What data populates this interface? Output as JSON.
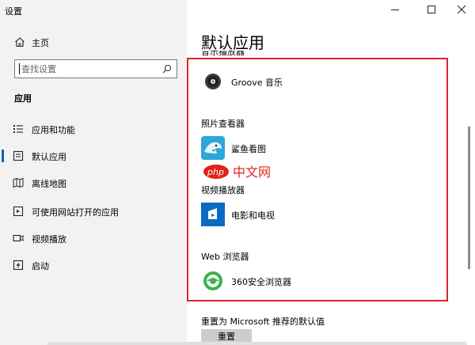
{
  "window": {
    "title": "设置"
  },
  "sidebar": {
    "home_label": "主页",
    "search_placeholder": "查找设置",
    "section_title": "应用",
    "items": [
      {
        "label": "应用和功能",
        "icon": "list-icon",
        "selected": false
      },
      {
        "label": "默认应用",
        "icon": "default-apps-icon",
        "selected": true
      },
      {
        "label": "离线地图",
        "icon": "map-icon",
        "selected": false
      },
      {
        "label": "可使用网站打开的应用",
        "icon": "website-app-icon",
        "selected": false
      },
      {
        "label": "视频播放",
        "icon": "video-icon",
        "selected": false
      },
      {
        "label": "启动",
        "icon": "startup-icon",
        "selected": false
      }
    ]
  },
  "main": {
    "title": "默认应用",
    "cut_heading": "音乐播放器",
    "categories": [
      {
        "label": "",
        "app": "Groove 音乐",
        "icon": "groove-music-icon"
      },
      {
        "label": "照片查看器",
        "app": "鲨鱼看图",
        "icon": "shark-viewer-icon"
      },
      {
        "label": "视频播放器",
        "app": "电影和电视",
        "icon": "movies-tv-icon"
      },
      {
        "label": "Web 浏览器",
        "app": "360安全浏览器",
        "icon": "360-browser-icon"
      }
    ],
    "watermark": "php 中文网",
    "reset_label": "重置为 Microsoft 推荐的默认值",
    "reset_button": "重置"
  },
  "colors": {
    "sidebar_bg": "#f2f2f2",
    "accent": "#0063b1",
    "highlight_box": "#e0202a"
  }
}
